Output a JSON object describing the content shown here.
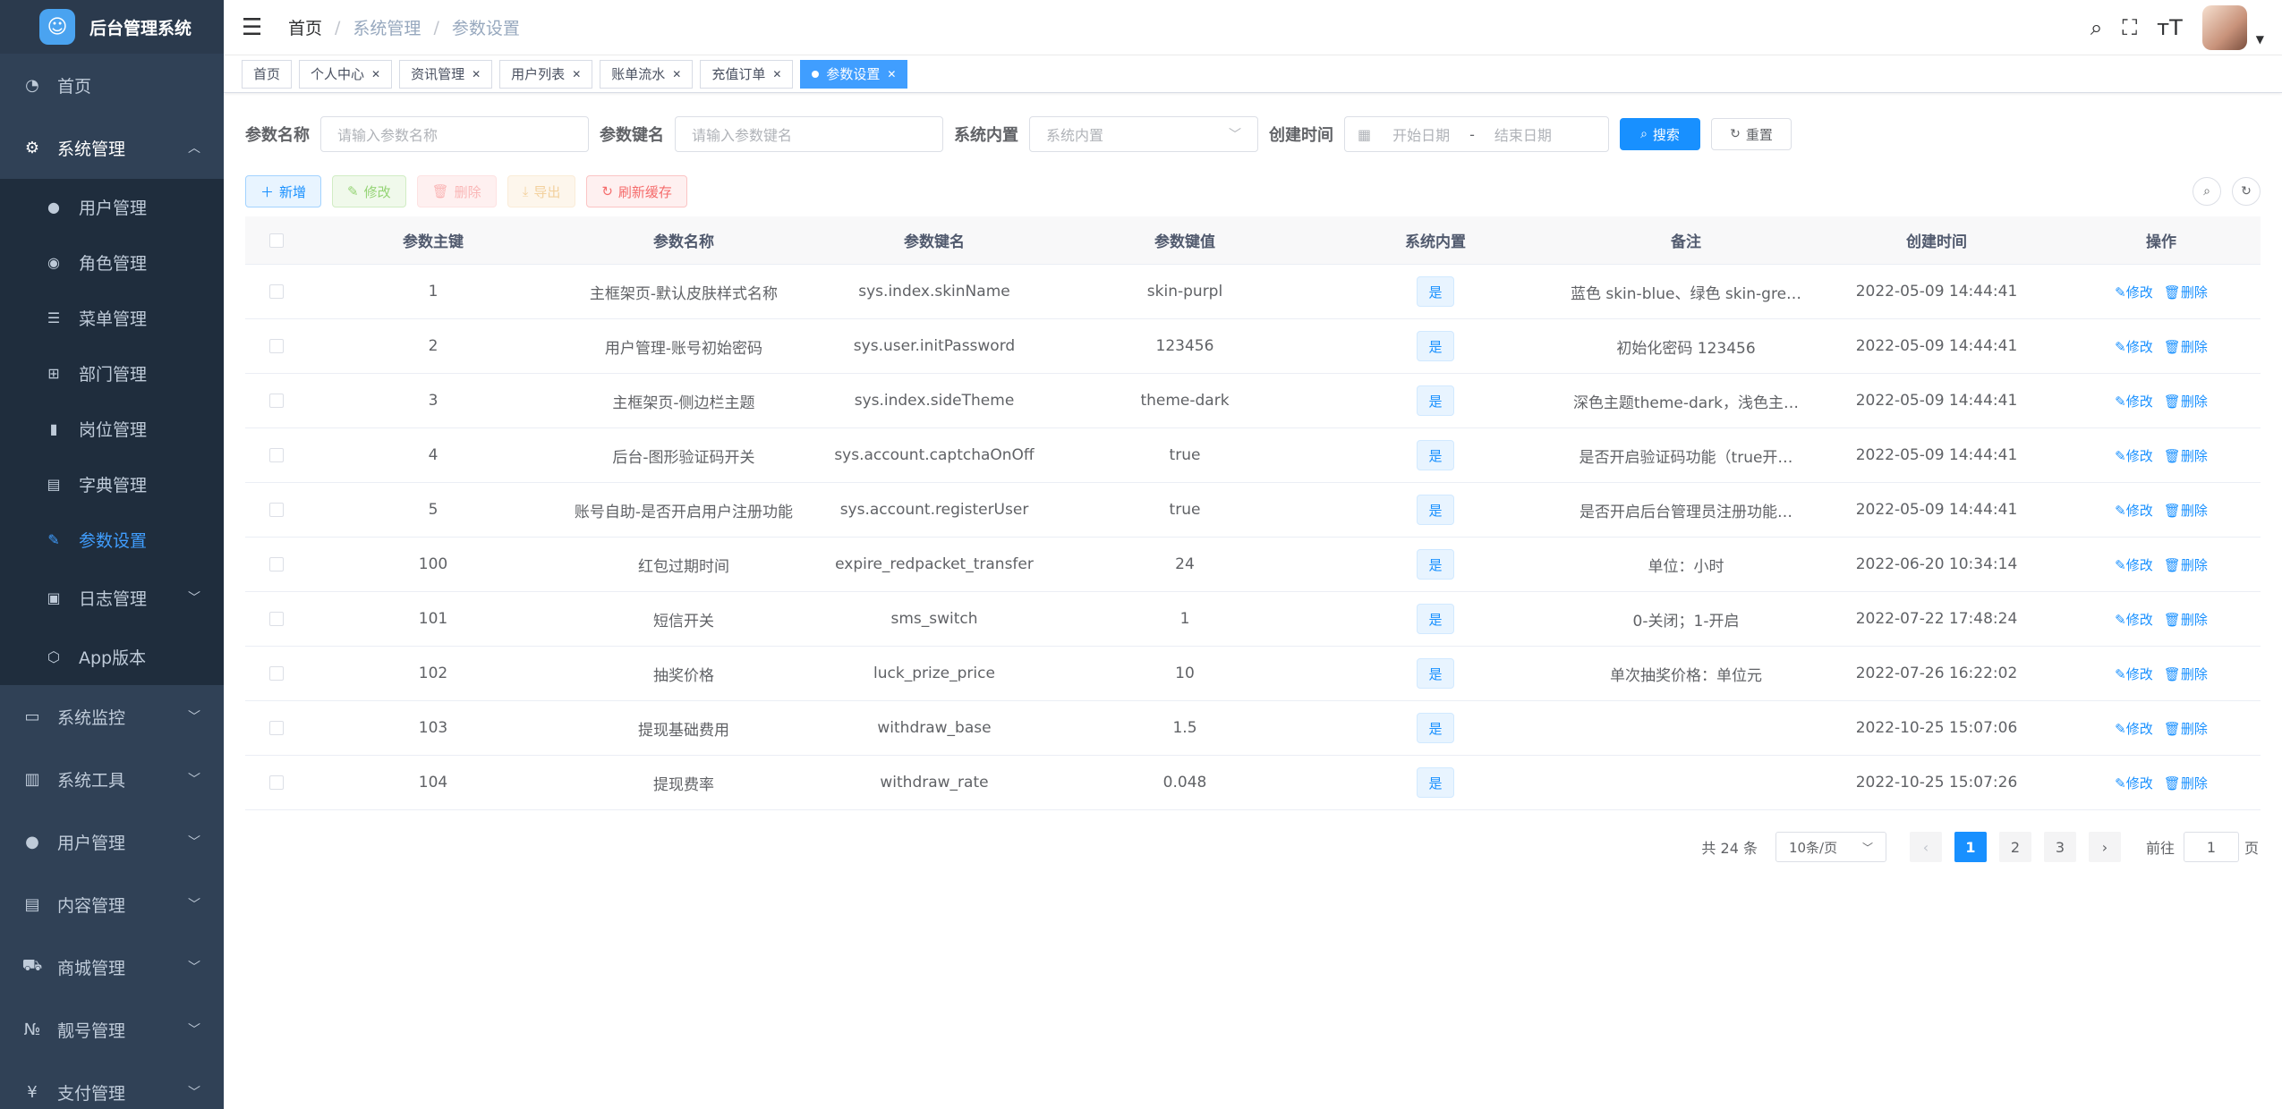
{
  "app": {
    "title": "后台管理系统"
  },
  "sidebar": {
    "items": [
      {
        "label": "首页",
        "icon": "dashboard-icon"
      },
      {
        "label": "系统管理",
        "icon": "gear-icon",
        "expanded": true,
        "children": [
          {
            "label": "用户管理",
            "icon": "user-icon"
          },
          {
            "label": "角色管理",
            "icon": "role-icon"
          },
          {
            "label": "菜单管理",
            "icon": "menu-tree-icon"
          },
          {
            "label": "部门管理",
            "icon": "org-tree-icon"
          },
          {
            "label": "岗位管理",
            "icon": "post-icon"
          },
          {
            "label": "字典管理",
            "icon": "dictionary-icon"
          },
          {
            "label": "参数设置",
            "icon": "edit-icon",
            "active": true
          },
          {
            "label": "日志管理",
            "icon": "log-icon",
            "has_children": true
          },
          {
            "label": "App版本",
            "icon": "cube-icon"
          }
        ]
      },
      {
        "label": "系统监控",
        "icon": "monitor-icon"
      },
      {
        "label": "系统工具",
        "icon": "toolbox-icon"
      },
      {
        "label": "用户管理",
        "icon": "user-icon"
      },
      {
        "label": "内容管理",
        "icon": "document-icon"
      },
      {
        "label": "商城管理",
        "icon": "cart-icon"
      },
      {
        "label": "靓号管理",
        "icon": "number-icon"
      },
      {
        "label": "支付管理",
        "icon": "payment-icon"
      }
    ]
  },
  "header": {
    "breadcrumb": [
      "首页",
      "系统管理",
      "参数设置"
    ]
  },
  "tags": [
    {
      "label": "首页",
      "closable": false
    },
    {
      "label": "个人中心",
      "closable": true
    },
    {
      "label": "资讯管理",
      "closable": true
    },
    {
      "label": "用户列表",
      "closable": true
    },
    {
      "label": "账单流水",
      "closable": true
    },
    {
      "label": "充值订单",
      "closable": true
    },
    {
      "label": "参数设置",
      "closable": true,
      "active": true
    }
  ],
  "filter": {
    "name_label": "参数名称",
    "name_placeholder": "请输入参数名称",
    "key_label": "参数键名",
    "key_placeholder": "请输入参数键名",
    "builtin_label": "系统内置",
    "builtin_placeholder": "系统内置",
    "time_label": "创建时间",
    "start_placeholder": "开始日期",
    "range_sep": "-",
    "end_placeholder": "结束日期",
    "search_label": "搜索",
    "reset_label": "重置"
  },
  "toolbar": {
    "add": "新增",
    "edit": "修改",
    "delete": "删除",
    "export": "导出",
    "refresh_cache": "刷新缓存"
  },
  "table": {
    "columns": [
      "参数主键",
      "参数名称",
      "参数键名",
      "参数键值",
      "系统内置",
      "备注",
      "创建时间",
      "操作"
    ],
    "edit_label": "修改",
    "delete_label": "删除",
    "rows": [
      {
        "id": "1",
        "name": "主框架页-默认皮肤样式名称",
        "key": "sys.index.skinName",
        "value": "skin-purpl",
        "builtin": "是",
        "remark": "蓝色 skin-blue、绿色 skin-gre…",
        "created": "2022-05-09 14:44:41"
      },
      {
        "id": "2",
        "name": "用户管理-账号初始密码",
        "key": "sys.user.initPassword",
        "value": "123456",
        "builtin": "是",
        "remark": "初始化密码 123456",
        "created": "2022-05-09 14:44:41"
      },
      {
        "id": "3",
        "name": "主框架页-侧边栏主题",
        "key": "sys.index.sideTheme",
        "value": "theme-dark",
        "builtin": "是",
        "remark": "深色主题theme-dark，浅色主…",
        "created": "2022-05-09 14:44:41"
      },
      {
        "id": "4",
        "name": "后台-图形验证码开关",
        "key": "sys.account.captchaOnOff",
        "value": "true",
        "builtin": "是",
        "remark": "是否开启验证码功能（true开…",
        "created": "2022-05-09 14:44:41"
      },
      {
        "id": "5",
        "name": "账号自助-是否开启用户注册功能",
        "key": "sys.account.registerUser",
        "value": "true",
        "builtin": "是",
        "remark": "是否开启后台管理员注册功能…",
        "created": "2022-05-09 14:44:41"
      },
      {
        "id": "100",
        "name": "红包过期时间",
        "key": "expire_redpacket_transfer",
        "value": "24",
        "builtin": "是",
        "remark": "单位：小时",
        "created": "2022-06-20 10:34:14"
      },
      {
        "id": "101",
        "name": "短信开关",
        "key": "sms_switch",
        "value": "1",
        "builtin": "是",
        "remark": "0-关闭；1-开启",
        "created": "2022-07-22 17:48:24"
      },
      {
        "id": "102",
        "name": "抽奖价格",
        "key": "luck_prize_price",
        "value": "10",
        "builtin": "是",
        "remark": "单次抽奖价格：单位元",
        "created": "2022-07-26 16:22:02"
      },
      {
        "id": "103",
        "name": "提现基础费用",
        "key": "withdraw_base",
        "value": "1.5",
        "builtin": "是",
        "remark": "",
        "created": "2022-10-25 15:07:06"
      },
      {
        "id": "104",
        "name": "提现费率",
        "key": "withdraw_rate",
        "value": "0.048",
        "builtin": "是",
        "remark": "",
        "created": "2022-10-25 15:07:26"
      }
    ]
  },
  "pagination": {
    "total_text": "共 24 条",
    "page_size": "10条/页",
    "pages": [
      "1",
      "2",
      "3"
    ],
    "current": "1",
    "goto_label": "前往",
    "goto_value": "1",
    "page_suffix": "页"
  }
}
